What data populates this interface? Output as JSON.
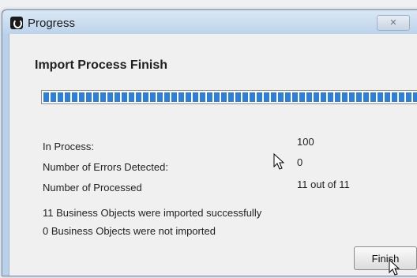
{
  "window": {
    "title": "Progress",
    "close_glyph": "✕",
    "app_icon": "app-icon"
  },
  "heading": "Import Process Finish",
  "progress": {
    "fraction": 1.0,
    "color": "#2f7fd6"
  },
  "stats": [
    {
      "label": "In Process:",
      "value": "100"
    },
    {
      "label": "Number of Errors Detected:",
      "value": "0"
    },
    {
      "label": "Number of Processed",
      "value": "11 out of 11"
    }
  ],
  "messages": [
    "11 Business Objects were imported successfully",
    "0 Business Objects were not imported"
  ],
  "buttons": {
    "finish_label": "Finish"
  }
}
